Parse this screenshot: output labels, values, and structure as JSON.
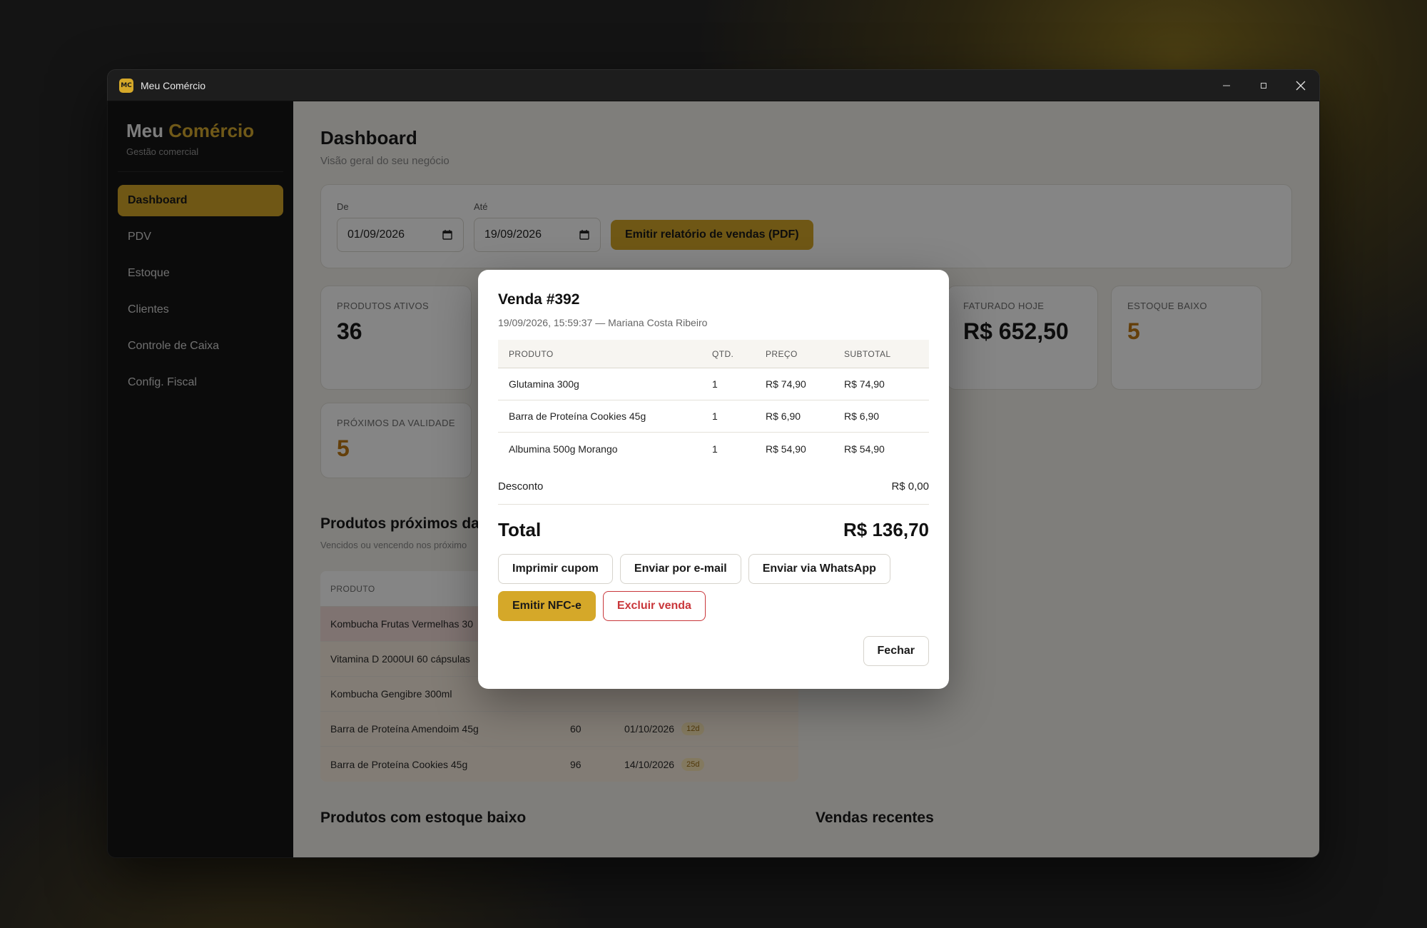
{
  "window": {
    "badge": "MC",
    "title": "Meu Comércio"
  },
  "sidebar": {
    "brand_main": "Meu",
    "brand_accent": "Comércio",
    "brand_sub": "Gestão comercial",
    "items": [
      {
        "label": "Dashboard",
        "active": true
      },
      {
        "label": "PDV"
      },
      {
        "label": "Estoque"
      },
      {
        "label": "Clientes"
      },
      {
        "label": "Controle de Caixa"
      },
      {
        "label": "Config. Fiscal"
      }
    ]
  },
  "main": {
    "title": "Dashboard",
    "subtitle": "Visão geral do seu negócio",
    "filter": {
      "from_label": "De",
      "from_value": "01/09/2026",
      "to_label": "Até",
      "to_value": "19/09/2026",
      "report_button": "Emitir relatório de vendas (PDF)"
    },
    "stats": [
      {
        "label": "PRODUTOS ATIVOS",
        "value": "36"
      },
      {
        "label": "FATURADO HOJE",
        "value": "R$ 652,50"
      },
      {
        "label": "ESTOQUE BAIXO",
        "value": "5"
      },
      {
        "label": "PRÓXIMOS DA VALIDADE",
        "value": "5"
      }
    ],
    "expiring": {
      "title": "Produtos próximos da",
      "subtitle": "Vencidos ou vencendo nos próximo",
      "header_product": "PRODUTO",
      "rows": [
        {
          "product": "Kombucha Frutas Vermelhas 30",
          "qty": "",
          "date": "",
          "days": ""
        },
        {
          "product": "Vitamina D 2000UI 60 cápsulas",
          "qty": "",
          "date": "",
          "days": ""
        },
        {
          "product": "Kombucha Gengibre 300ml",
          "qty": "",
          "date": "",
          "days": ""
        },
        {
          "product": "Barra de Proteína Amendoim 45g",
          "qty": "60",
          "date": "01/10/2026",
          "days": "12d"
        },
        {
          "product": "Barra de Proteína Cookies 45g",
          "qty": "96",
          "date": "14/10/2026",
          "days": "25d"
        }
      ]
    },
    "low_stock_title": "Produtos com estoque baixo",
    "recent_sales_title": "Vendas recentes"
  },
  "modal": {
    "title": "Venda #392",
    "subtitle": "19/09/2026, 15:59:37 — Mariana Costa Ribeiro",
    "headers": {
      "product": "PRODUTO",
      "qty": "QTD.",
      "price": "PREÇO",
      "subtotal": "SUBTOTAL"
    },
    "items": [
      {
        "product": "Glutamina 300g",
        "qty": "1",
        "price": "R$ 74,90",
        "subtotal": "R$ 74,90"
      },
      {
        "product": "Barra de Proteína Cookies 45g",
        "qty": "1",
        "price": "R$ 6,90",
        "subtotal": "R$ 6,90"
      },
      {
        "product": "Albumina 500g Morango",
        "qty": "1",
        "price": "R$ 54,90",
        "subtotal": "R$ 54,90"
      }
    ],
    "discount_label": "Desconto",
    "discount_value": "R$ 0,00",
    "total_label": "Total",
    "total_value": "R$ 136,70",
    "buttons": {
      "print": "Imprimir cupom",
      "email": "Enviar por e-mail",
      "whatsapp": "Enviar via WhatsApp",
      "nfce": "Emitir NFC-e",
      "delete": "Excluir venda",
      "close": "Fechar"
    }
  },
  "colors": {
    "accent": "#d5a829",
    "danger": "#c9363a",
    "warning_value": "#c07a14"
  }
}
